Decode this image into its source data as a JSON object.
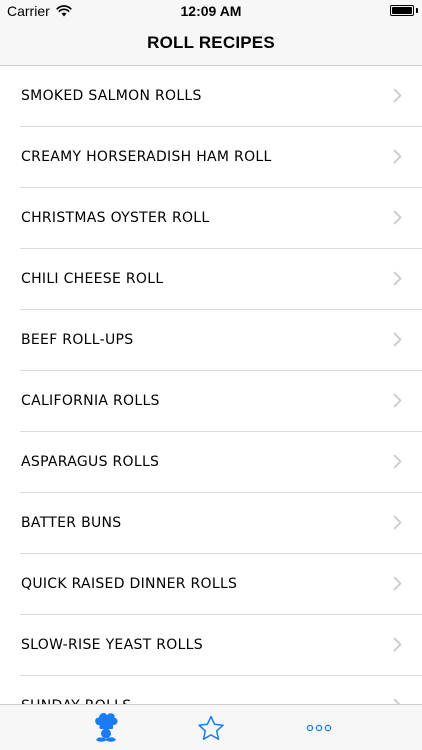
{
  "status_bar": {
    "carrier": "Carrier",
    "time": "12:09 AM",
    "battery_level": 1.0,
    "wifi_icon": "wifi-icon",
    "battery_icon": "battery-icon"
  },
  "nav": {
    "title": "ROLL RECIPES"
  },
  "recipes": [
    {
      "label": "SMOKED SALMON ROLLS"
    },
    {
      "label": "CREAMY HORSERADISH HAM ROLL"
    },
    {
      "label": "CHRISTMAS OYSTER ROLL"
    },
    {
      "label": "CHILI CHEESE ROLL"
    },
    {
      "label": "BEEF ROLL-UPS"
    },
    {
      "label": "CALIFORNIA ROLLS"
    },
    {
      "label": "ASPARAGUS ROLLS"
    },
    {
      "label": "BATTER BUNS"
    },
    {
      "label": "QUICK RAISED DINNER ROLLS"
    },
    {
      "label": "SLOW-RISE YEAST ROLLS"
    },
    {
      "label": "SUNDAY ROLLS"
    }
  ],
  "tab_bar": {
    "tabs": [
      {
        "icon": "chef-icon",
        "selected": true
      },
      {
        "icon": "star-icon",
        "selected": false
      },
      {
        "icon": "more-icon",
        "selected": false
      }
    ],
    "accent_color": "#1a7cf5"
  }
}
